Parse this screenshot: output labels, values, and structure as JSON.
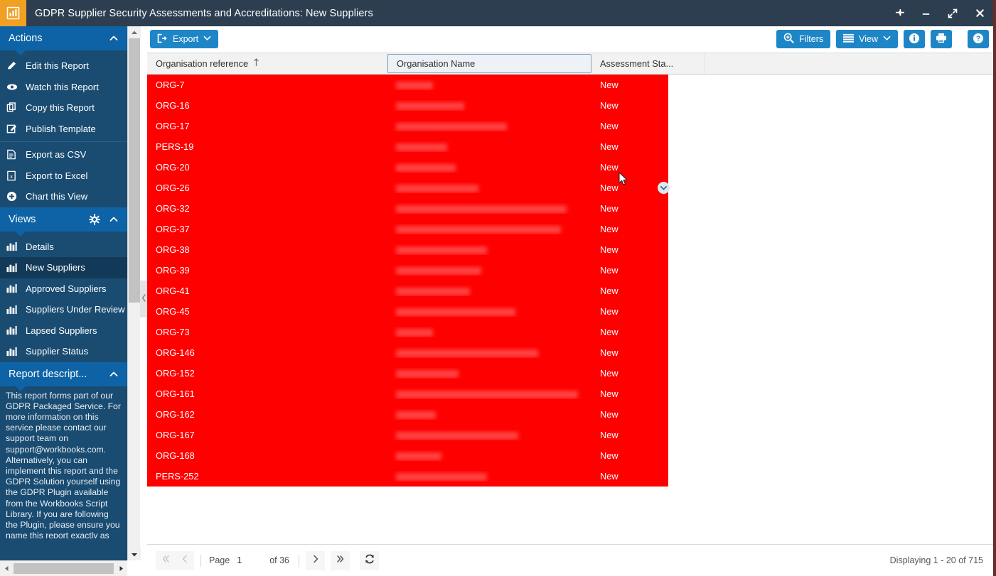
{
  "window": {
    "title": "GDPR Supplier Security Assessments and Accreditations: New Suppliers",
    "logo_icon": "bar-chart-icon",
    "controls": [
      {
        "name": "pin-icon",
        "label": "Pin"
      },
      {
        "name": "minimize-icon",
        "label": "Minimize"
      },
      {
        "name": "maximize-icon",
        "label": "Maximize"
      },
      {
        "name": "close-icon",
        "label": "Close"
      }
    ]
  },
  "colors": {
    "titlebar": "#2c3e50",
    "logo": "#f0a022",
    "panel_header": "#0d63a5",
    "sidebar": "#1a4c72",
    "sidebar_selected": "#123a58",
    "accent_button": "#1e86c7",
    "row_highlight": "#ff0000",
    "grid_header": "#f2f2f2"
  },
  "sidebar": {
    "actions": {
      "title": "Actions",
      "collapse_icon": "chevron-up-icon",
      "group1": [
        {
          "label": "Edit this Report",
          "icon": "pencil-icon"
        },
        {
          "label": "Watch this Report",
          "icon": "eye-icon"
        },
        {
          "label": "Copy this Report",
          "icon": "copy-icon"
        },
        {
          "label": "Publish Template",
          "icon": "pencil-square-icon"
        }
      ],
      "group2": [
        {
          "label": "Export as CSV",
          "icon": "document-icon"
        },
        {
          "label": "Export to Excel",
          "icon": "excel-icon"
        },
        {
          "label": "Chart this View",
          "icon": "plus-circle-icon"
        }
      ]
    },
    "views": {
      "title": "Views",
      "gear_icon": "gear-icon",
      "collapse_icon": "chevron-up-icon",
      "items": [
        {
          "label": "Details",
          "icon": "bar-chart-icon",
          "selected": false
        },
        {
          "label": "New Suppliers",
          "icon": "bar-chart-icon",
          "selected": true
        },
        {
          "label": "Approved Suppliers",
          "icon": "bar-chart-icon",
          "selected": false
        },
        {
          "label": "Suppliers Under Review",
          "icon": "bar-chart-icon",
          "selected": false
        },
        {
          "label": "Lapsed Suppliers",
          "icon": "bar-chart-icon",
          "selected": false
        },
        {
          "label": "Supplier Status",
          "icon": "bar-chart-icon",
          "selected": false
        }
      ]
    },
    "report_description": {
      "title": "Report descript...",
      "collapse_icon": "chevron-up-icon",
      "text": "This report forms part of our GDPR Packaged Service. For more information on this service please contact our support team on support@workbooks.com. Alternatively, you can implement this report and the GDPR Solution yourself using the GDPR Plugin available from the Workbooks Script Library. If you are following the Plugin, please ensure you name this report exactly as specified otherwise you will not be able"
    },
    "collapse_handle_icon": "chevron-left-icon",
    "scrollbar": {
      "up_icon": "triangle-up-icon",
      "down_icon": "triangle-down-icon",
      "left_icon": "triangle-left-icon",
      "right_icon": "triangle-right-icon"
    }
  },
  "toolbar": {
    "export": {
      "label": "Export",
      "icon": "export-icon",
      "chevron": "chevron-down-icon"
    },
    "filters": {
      "label": "Filters",
      "icon": "search-plus-icon"
    },
    "view": {
      "label": "View",
      "icon": "list-icon",
      "chevron": "chevron-down-icon"
    },
    "info": {
      "label": "Info",
      "icon": "info-icon"
    },
    "print": {
      "label": "Print",
      "icon": "printer-icon"
    },
    "help": {
      "label": "Help",
      "icon": "question-icon"
    }
  },
  "grid": {
    "columns": [
      {
        "label": "Organisation reference",
        "sort": "ascending",
        "sort_icon": "arrow-up-icon",
        "active": false
      },
      {
        "label": "Organisation Name",
        "sort": "none",
        "active": true
      },
      {
        "label": "Assessment Sta...",
        "sort": "none",
        "active": false
      },
      {
        "label": "",
        "sort": "none",
        "active": false
      }
    ],
    "row_menu_icon": "chevron-down-circle-icon",
    "row_menu_row_index": 5,
    "rows": [
      {
        "reference": "ORG-7",
        "organisation_name": "",
        "status": "New",
        "name_width": 52
      },
      {
        "reference": "ORG-16",
        "organisation_name": "",
        "status": "New",
        "name_width": 96
      },
      {
        "reference": "ORG-17",
        "organisation_name": "",
        "status": "New",
        "name_width": 156
      },
      {
        "reference": "PERS-19",
        "organisation_name": "",
        "status": "New",
        "name_width": 72
      },
      {
        "reference": "ORG-20",
        "organisation_name": "",
        "status": "New",
        "name_width": 84
      },
      {
        "reference": "ORG-26",
        "organisation_name": "",
        "status": "New",
        "name_width": 116
      },
      {
        "reference": "ORG-32",
        "organisation_name": "",
        "status": "New",
        "name_width": 240
      },
      {
        "reference": "ORG-37",
        "organisation_name": "",
        "status": "New",
        "name_width": 232
      },
      {
        "reference": "ORG-38",
        "organisation_name": "",
        "status": "New",
        "name_width": 128
      },
      {
        "reference": "ORG-39",
        "organisation_name": "",
        "status": "New",
        "name_width": 120
      },
      {
        "reference": "ORG-41",
        "organisation_name": "",
        "status": "New",
        "name_width": 104
      },
      {
        "reference": "ORG-45",
        "organisation_name": "",
        "status": "New",
        "name_width": 168
      },
      {
        "reference": "ORG-73",
        "organisation_name": "",
        "status": "New",
        "name_width": 52
      },
      {
        "reference": "ORG-146",
        "organisation_name": "",
        "status": "New",
        "name_width": 200
      },
      {
        "reference": "ORG-152",
        "organisation_name": "",
        "status": "New",
        "name_width": 88
      },
      {
        "reference": "ORG-161",
        "organisation_name": "",
        "status": "New",
        "name_width": 256
      },
      {
        "reference": "ORG-162",
        "organisation_name": "",
        "status": "New",
        "name_width": 56
      },
      {
        "reference": "ORG-167",
        "organisation_name": "",
        "status": "New",
        "name_width": 172
      },
      {
        "reference": "ORG-168",
        "organisation_name": "",
        "status": "New",
        "name_width": 64
      },
      {
        "reference": "PERS-252",
        "organisation_name": "",
        "status": "New",
        "name_width": 128
      }
    ]
  },
  "pagination": {
    "first_icon": "double-chevron-left-icon",
    "prev_icon": "chevron-left-icon",
    "page_label": "Page",
    "page_value": "1",
    "of_label": "of 36",
    "next_icon": "chevron-right-icon",
    "last_icon": "double-chevron-right-icon",
    "refresh_icon": "refresh-icon",
    "displaying": "Displaying 1 - 20 of 715"
  }
}
